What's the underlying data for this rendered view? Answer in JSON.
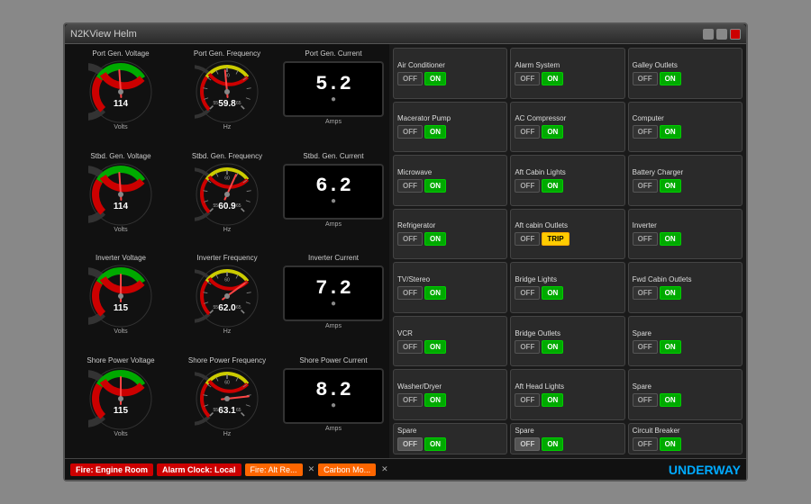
{
  "window": {
    "title": "N2KView Helm"
  },
  "gauges": [
    {
      "label": "Port Gen. Voltage",
      "value": "114",
      "unit": "Volts",
      "type": "voltage",
      "min": 80,
      "max": 150,
      "needle": 114
    },
    {
      "label": "Port Gen. Frequency",
      "value": "59.8",
      "unit": "Hz",
      "type": "frequency",
      "min": 55,
      "max": 65,
      "needle": 59.8
    },
    {
      "label": "Port Gen. Current",
      "value": "5.2",
      "unit": "Amps",
      "type": "current"
    },
    {
      "label": "Stbd. Gen. Voltage",
      "value": "114",
      "unit": "Volts",
      "type": "voltage",
      "min": 80,
      "max": 150,
      "needle": 114
    },
    {
      "label": "Stbd. Gen. Frequency",
      "value": "60.9",
      "unit": "Hz",
      "type": "frequency",
      "min": 55,
      "max": 65,
      "needle": 60.9
    },
    {
      "label": "Stbd. Gen. Current",
      "value": "6.2",
      "unit": "Amps",
      "type": "current"
    },
    {
      "label": "Inverter Voltage",
      "value": "115",
      "unit": "Volts",
      "type": "voltage",
      "min": 80,
      "max": 150,
      "needle": 115
    },
    {
      "label": "Inverter Frequency",
      "value": "62.0",
      "unit": "Hz",
      "type": "frequency",
      "min": 55,
      "max": 65,
      "needle": 62.0
    },
    {
      "label": "Inverter Current",
      "value": "7.2",
      "unit": "Amps",
      "type": "current"
    },
    {
      "label": "Shore Power Voltage",
      "value": "115",
      "unit": "Volts",
      "type": "voltage",
      "min": 80,
      "max": 150,
      "needle": 115
    },
    {
      "label": "Shore Power Frequency",
      "value": "63.1",
      "unit": "Hz",
      "type": "frequency",
      "min": 55,
      "max": 65,
      "needle": 63.1
    },
    {
      "label": "Shore Power Current",
      "value": "8.2",
      "unit": "Amps",
      "type": "current"
    }
  ],
  "switches": [
    {
      "name": "Air Conditioner",
      "state": "on"
    },
    {
      "name": "Alarm System",
      "state": "on"
    },
    {
      "name": "Galley Outlets",
      "state": "on"
    },
    {
      "name": "Macerator Pump",
      "state": "on"
    },
    {
      "name": "AC Compressor",
      "state": "on"
    },
    {
      "name": "Computer",
      "state": "on"
    },
    {
      "name": "Microwave",
      "state": "on"
    },
    {
      "name": "Aft Cabin Lights",
      "state": "on"
    },
    {
      "name": "Battery Charger",
      "state": "on"
    },
    {
      "name": "Refrigerator",
      "state": "on"
    },
    {
      "name": "Aft cabin Outlets",
      "state": "trip"
    },
    {
      "name": "Inverter",
      "state": "on"
    },
    {
      "name": "TV/Stereo",
      "state": "on"
    },
    {
      "name": "Bridge Lights",
      "state": "on"
    },
    {
      "name": "Fwd Cabin Outlets",
      "state": "on"
    },
    {
      "name": "VCR",
      "state": "on"
    },
    {
      "name": "Bridge Outlets",
      "state": "on"
    },
    {
      "name": "Spare",
      "state": "on"
    },
    {
      "name": "Washer/Dryer",
      "state": "on"
    },
    {
      "name": "Aft Head Lights",
      "state": "on"
    },
    {
      "name": "Spare",
      "state": "on"
    },
    {
      "name": "Spare",
      "state": "off"
    },
    {
      "name": "Spare",
      "state": "off"
    },
    {
      "name": "Circuit Breaker",
      "state": "on"
    }
  ],
  "statusBar": {
    "alarms": [
      "Fire: Engine Room",
      "Alarm Clock: Local"
    ],
    "alerts": [
      "Fire: Alt Re...",
      "Carbon Mo..."
    ],
    "underway": "UNDERWAY"
  }
}
